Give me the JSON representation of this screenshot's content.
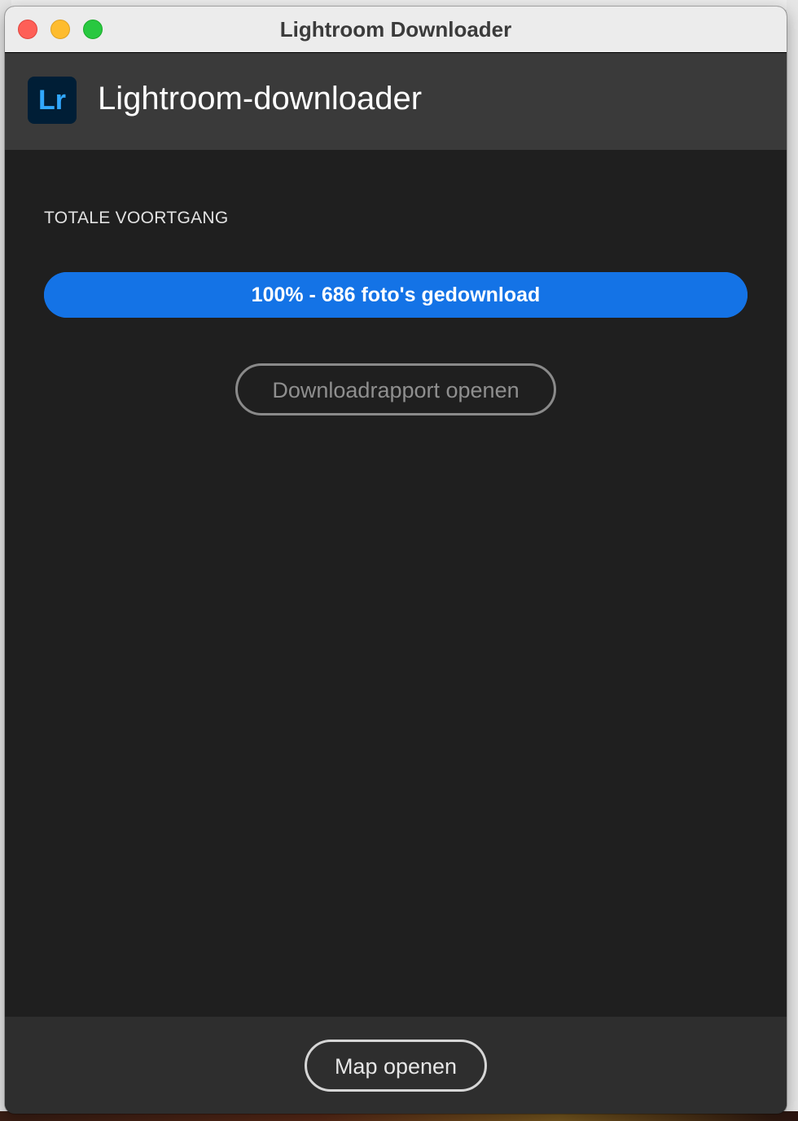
{
  "window": {
    "title": "Lightroom Downloader"
  },
  "header": {
    "logo_text": "Lr",
    "app_name": "Lightroom-downloader"
  },
  "progress": {
    "section_label": "TOTALE VOORTGANG",
    "percent": 100,
    "status_text": "100% - 686 foto's gedownload",
    "fill_color": "#1473e6"
  },
  "actions": {
    "report_label": "Downloadrapport openen",
    "open_folder_label": "Map openen"
  },
  "colors": {
    "accent": "#1473e6",
    "logo_bg": "#001e36",
    "logo_fg": "#31a8ff"
  }
}
